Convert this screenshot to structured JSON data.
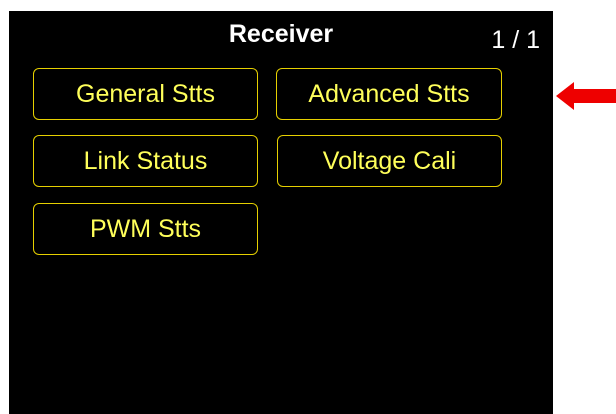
{
  "screen": {
    "title": "Receiver",
    "page_indicator": "1 / 1",
    "background": "#000000",
    "text_color": "#ffffff",
    "button_text_color": "#ffff5a",
    "button_border_color": "#e6d000"
  },
  "menu": {
    "items": [
      {
        "label": "General Stts"
      },
      {
        "label": "Advanced Stts"
      },
      {
        "label": "Link Status"
      },
      {
        "label": "Voltage Cali"
      },
      {
        "label": "PWM Stts"
      }
    ]
  },
  "annotation": {
    "icon": "red-arrow-left-icon",
    "color": "#ee0000"
  }
}
